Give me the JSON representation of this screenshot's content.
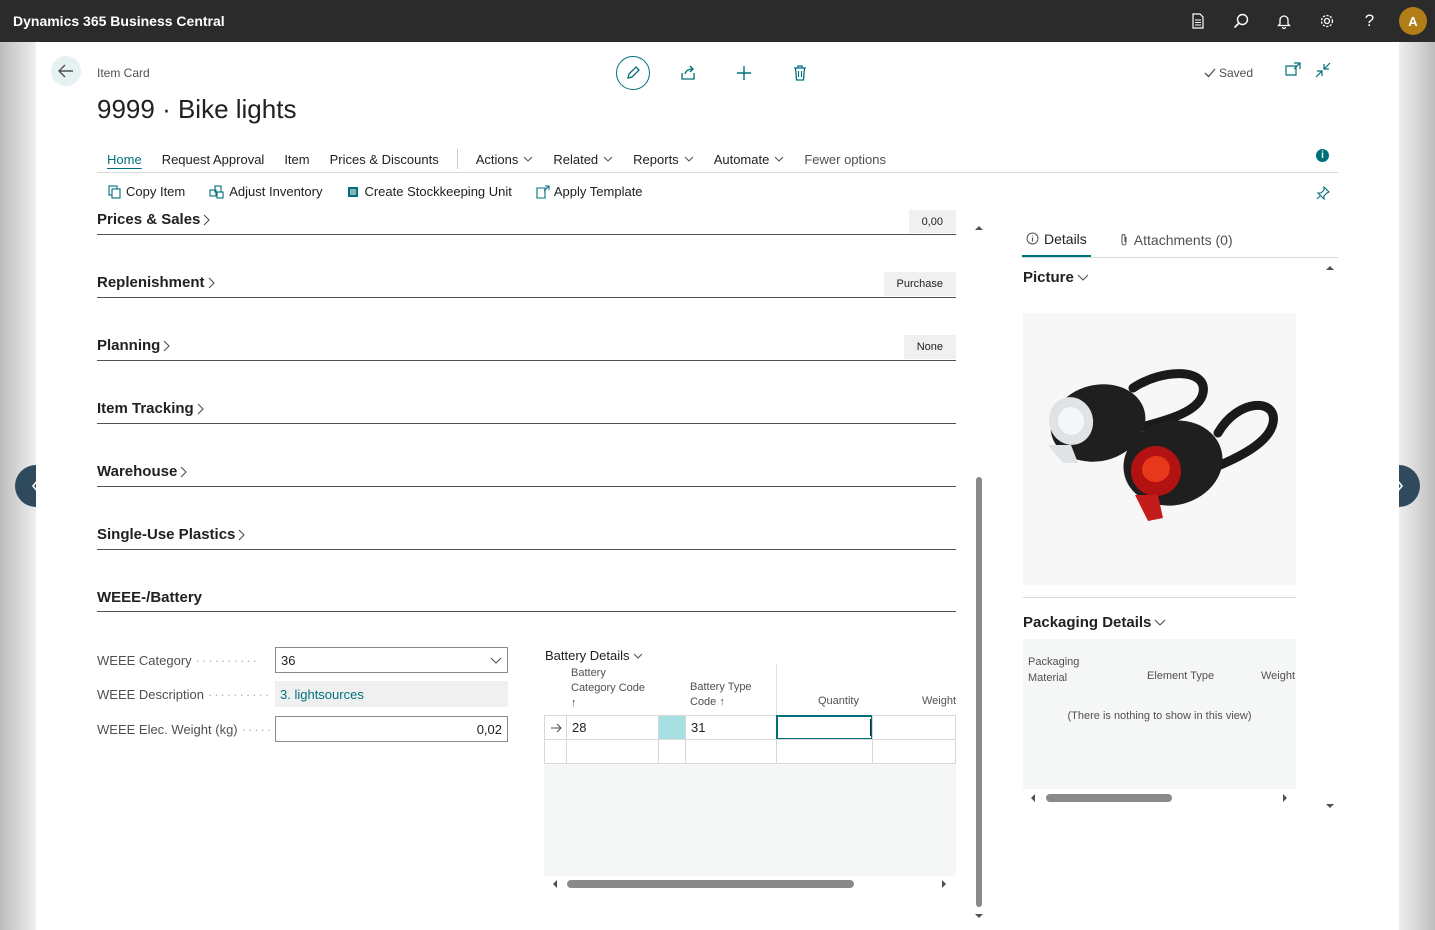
{
  "app": {
    "title": "Dynamics 365 Business Central",
    "avatar_initial": "A"
  },
  "header": {
    "caption": "Item Card",
    "title": "9999 · Bike lights",
    "saved_label": "Saved"
  },
  "actionbar": {
    "items": [
      "Home",
      "Request Approval",
      "Item",
      "Prices & Discounts"
    ],
    "menus": [
      "Actions",
      "Related",
      "Reports",
      "Automate"
    ],
    "fewer_options": "Fewer options"
  },
  "promoted": {
    "items": [
      "Copy Item",
      "Adjust Inventory",
      "Create Stockkeeping Unit",
      "Apply Template"
    ]
  },
  "fasttabs": {
    "prices_sales": {
      "title": "Prices & Sales",
      "summary": "0,00"
    },
    "replenishment": {
      "title": "Replenishment",
      "summary": "Purchase"
    },
    "planning": {
      "title": "Planning",
      "summary": "None"
    },
    "item_tracking": {
      "title": "Item Tracking"
    },
    "warehouse": {
      "title": "Warehouse"
    },
    "single_use_plastics": {
      "title": "Single-Use Plastics"
    },
    "weee_battery": {
      "title": "WEEE-/Battery"
    }
  },
  "weee": {
    "category_label": "WEEE Category",
    "category_value": "36",
    "description_label": "WEEE Description",
    "description_value": "3. lightsources",
    "weight_label": "WEEE Elec. Weight (kg)",
    "weight_value": "0,02"
  },
  "battery_details": {
    "title": "Battery Details",
    "columns": {
      "category_line1": "Battery",
      "category_line2": "Category Code",
      "type_line1": "Battery Type",
      "type_line2": "Code",
      "quantity": "Quantity",
      "weight": "Weight"
    },
    "row": {
      "category_code": "28",
      "type_code": "31",
      "quantity": ""
    }
  },
  "factbox": {
    "tab_details": "Details",
    "tab_attachments": "Attachments (0)",
    "picture_title": "Picture",
    "packaging_title": "Packaging Details",
    "packaging_columns": {
      "material_line1": "Packaging",
      "material_line2": "Material",
      "element_type": "Element Type",
      "weight": "Weight"
    },
    "empty_text": "(There is nothing to show in this view)"
  },
  "colors": {
    "accent": "#00707a",
    "topbar": "#2b2b2b",
    "nav_arrow": "#2e4a5c",
    "avatar": "#b07d16"
  },
  "icons": [
    "document-icon",
    "search-icon",
    "bell-icon",
    "gear-icon",
    "help-icon",
    "back-arrow-icon",
    "edit-icon",
    "share-icon",
    "add-icon",
    "delete-icon",
    "checkmark-icon",
    "open-new-window-icon",
    "collapse-icon",
    "info-icon",
    "pin-icon",
    "chevron-left-icon",
    "chevron-right-icon"
  ]
}
